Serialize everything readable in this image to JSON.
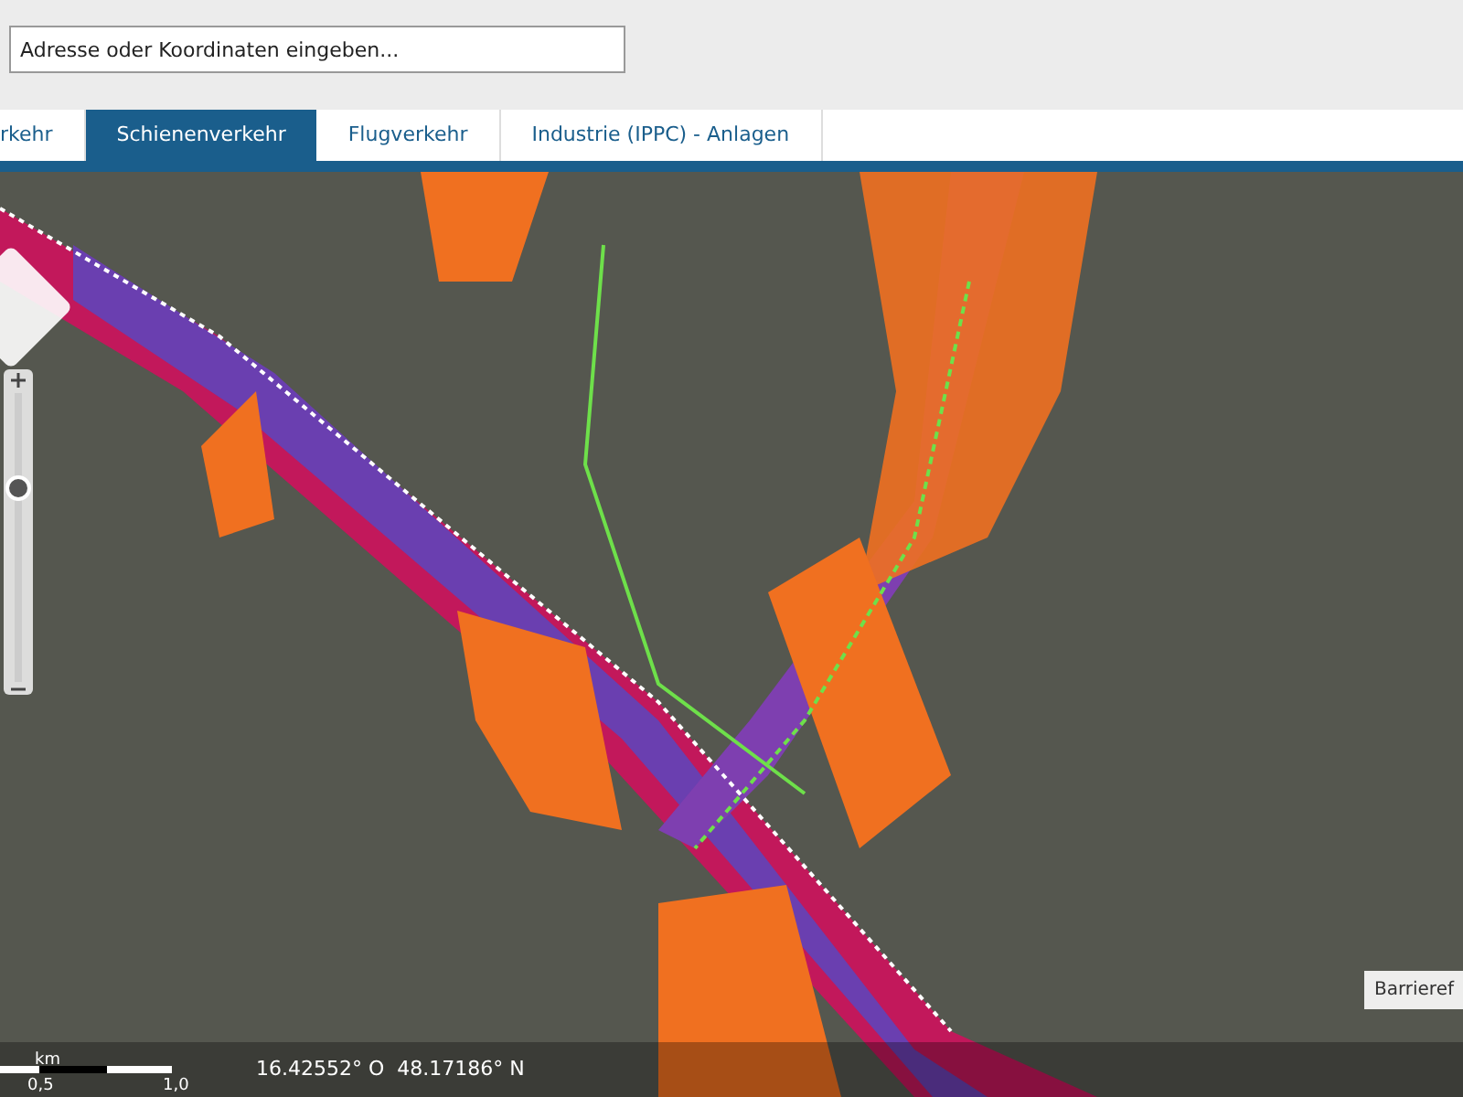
{
  "search": {
    "placeholder": "Adresse oder Koordinaten eingeben..."
  },
  "tabs": [
    {
      "label": "rkehr",
      "selected": false
    },
    {
      "label": "Schienenverkehr",
      "selected": true
    },
    {
      "label": "Flugverkehr",
      "selected": false
    },
    {
      "label": "Industrie (IPPC) - Anlagen",
      "selected": false
    }
  ],
  "map": {
    "zoom_slider": {
      "level": 0.67
    },
    "badge": "Barrieref",
    "scale": {
      "unit": "km",
      "labels": [
        "0,5",
        "1,0"
      ]
    },
    "coordinates": "16.42552° O  48.17186° N"
  }
}
